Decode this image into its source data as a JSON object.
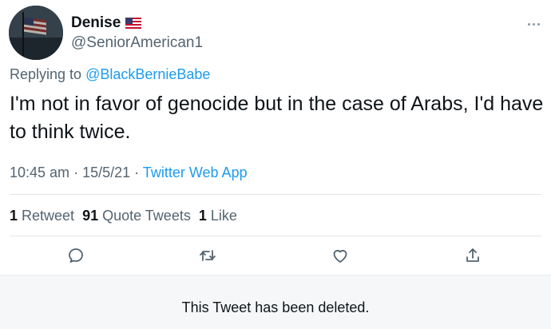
{
  "author": {
    "display_name": "Denise",
    "handle": "@SeniorAmerican1",
    "flag_icon": "us-flag-icon"
  },
  "reply": {
    "prefix": "Replying to",
    "target": "@BlackBernieBabe"
  },
  "tweet": {
    "text": "I'm not in favor of genocide but in the case of Arabs, I'd have to think twice."
  },
  "meta": {
    "time": "10:45 am",
    "date": "15/5/21",
    "separator": "·",
    "source": "Twitter Web App"
  },
  "stats": {
    "retweets_count": "1",
    "retweets_label": "Retweet",
    "quotes_count": "91",
    "quotes_label": "Quote Tweets",
    "likes_count": "1",
    "likes_label": "Like"
  },
  "actions": [
    "reply-icon",
    "retweet-icon",
    "like-icon",
    "share-icon"
  ],
  "quoted": {
    "deleted_message": "This Tweet has been deleted."
  },
  "colors": {
    "accent": "#1d9bf0",
    "secondary_text": "#536471",
    "deleted_bg": "#f5f7f8"
  }
}
